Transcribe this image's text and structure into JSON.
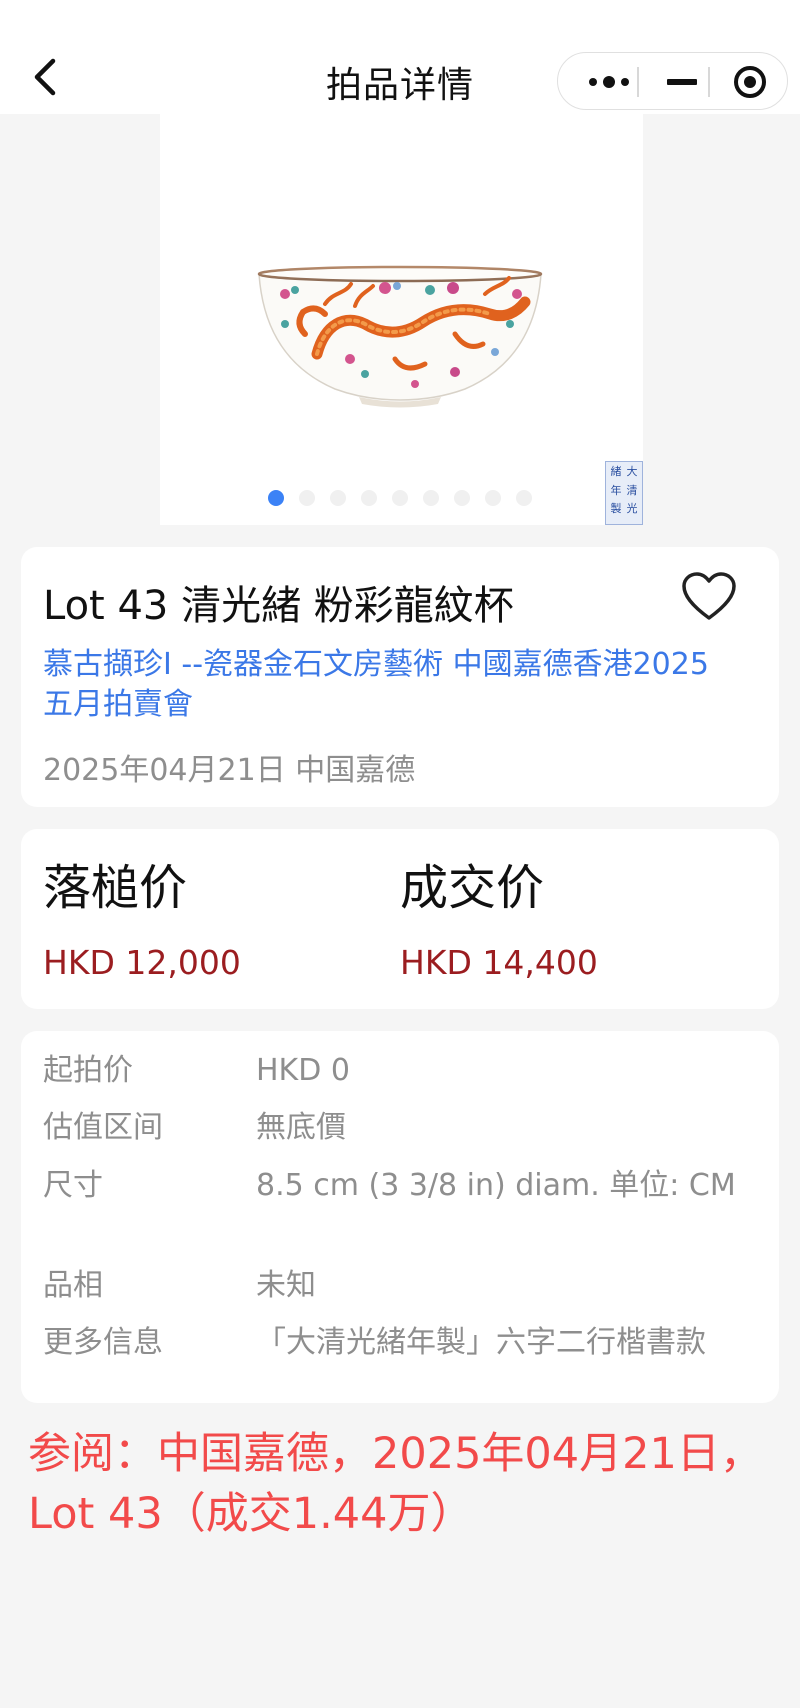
{
  "header": {
    "title": "拍品详情"
  },
  "gallery": {
    "image_alt": "粉彩龍紋杯",
    "slide_count": 9,
    "active_index": 0,
    "seal_text": [
      "大",
      "清",
      "光",
      "緒",
      "年",
      "製"
    ]
  },
  "lot": {
    "title": "Lot 43 清光緒 粉彩龍紋杯",
    "sale_name": "慕古擷珍I --瓷器金石文房藝術 中國嘉德香港2025五月拍賣會",
    "date_house": "2025年04月21日 中国嘉德",
    "favorited": false
  },
  "prices": {
    "hammer_label": "落槌价",
    "hammer_value": "HKD 12,000",
    "final_label": "成交价",
    "final_value": "HKD 14,400"
  },
  "info": {
    "rows": [
      {
        "key": "起拍价",
        "value": "HKD 0"
      },
      {
        "key": "估值区间",
        "value": "無底價"
      },
      {
        "key": "尺寸",
        "value": "8.5 cm (3 3/8 in) diam. 单位: CM"
      },
      {
        "key": "品相",
        "value": "未知"
      },
      {
        "key": "更多信息",
        "value": "「大清光緒年製」六字二行楷書款"
      }
    ]
  },
  "reference_note": "参阅：中国嘉德，2025年04月21日，Lot 43（成交1.44万）",
  "colors": {
    "accent_blue": "#3b78e7",
    "price_red": "#9b1d20",
    "note_red": "#f24a4a",
    "dot_active": "#3b82f6"
  }
}
